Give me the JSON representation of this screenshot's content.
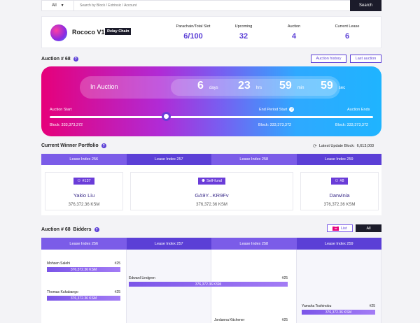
{
  "search": {
    "select_value": "All",
    "placeholder": "Search by Block / Extrinsic / Account",
    "button": "Search"
  },
  "chain": {
    "name": "Rococo V1",
    "tag": "Relay Chain",
    "stats": [
      {
        "label": "Parachain/Total Slot",
        "value": "6/100"
      },
      {
        "label": "Upcoming",
        "value": "32"
      },
      {
        "label": "Auction",
        "value": "4"
      },
      {
        "label": "Current Lease",
        "value": "6"
      }
    ]
  },
  "auction": {
    "title": "Auction # 68",
    "history_button": "Auction history",
    "last_button": "Last auction",
    "status": "In Auction",
    "countdown": [
      {
        "value": "6",
        "unit": "days"
      },
      {
        "value": "23",
        "unit": "hrs"
      },
      {
        "value": "59",
        "unit": "min"
      },
      {
        "value": "59",
        "unit": "sec"
      }
    ],
    "progress": 0.36,
    "start_label": "Auction Start",
    "end_period_label": "End Period Start",
    "ends_label": "Auction Ends",
    "start_block": "Block:  333,373,372",
    "end_period_block": "Block:  333,373,372",
    "ends_block": "Block:  333,373,372"
  },
  "portfolio": {
    "title": "Current Winner Portfolio",
    "update_label": "Latest Update Block:",
    "update_value": "6,613,003",
    "tabs": [
      "Lease Index 256",
      "Lease Index 257",
      "Lease Index 258",
      "Lease Index 259"
    ],
    "winners": [
      {
        "badge": "#137",
        "name": "Yakio Liu",
        "amount": "376,372.36 KSM"
      },
      {
        "badge": "Self-fund",
        "name": "GA9Y...KR9Fv",
        "amount": "376,372.36 KSM"
      },
      {
        "badge": "#8",
        "name": "Darwinia",
        "amount": "376,372.36 KSM"
      }
    ]
  },
  "bidders": {
    "title": "Auction # 68  Bidders",
    "toggle_list": "List",
    "toggle_all": "All",
    "tabs": [
      "Lease Index 256",
      "Lease Index 257",
      "Lease Index 258",
      "Lease Index 259"
    ],
    "rows": [
      {
        "name": "Mohsen Salehi",
        "rank": "#25",
        "amount": "376,372.36 KSM"
      },
      {
        "name": "Thomas Kukabango",
        "rank": "#25",
        "amount": "376,372.36 KSM"
      },
      {
        "name": "Edward Lindgren",
        "rank": "#25",
        "amount": "376,372.36 KSM"
      },
      {
        "name": "Yamaha Toshinobu",
        "rank": "#25",
        "amount": "376,372.36 KSM"
      },
      {
        "name": "Jordanna Kitchener",
        "rank": "#25",
        "amount": ""
      }
    ]
  },
  "colors": {
    "accent": "#5b3fd6",
    "tab_dark": "#5b3fd6",
    "tab_light": "#7b5ce8",
    "dark": "#1b1b2a"
  }
}
